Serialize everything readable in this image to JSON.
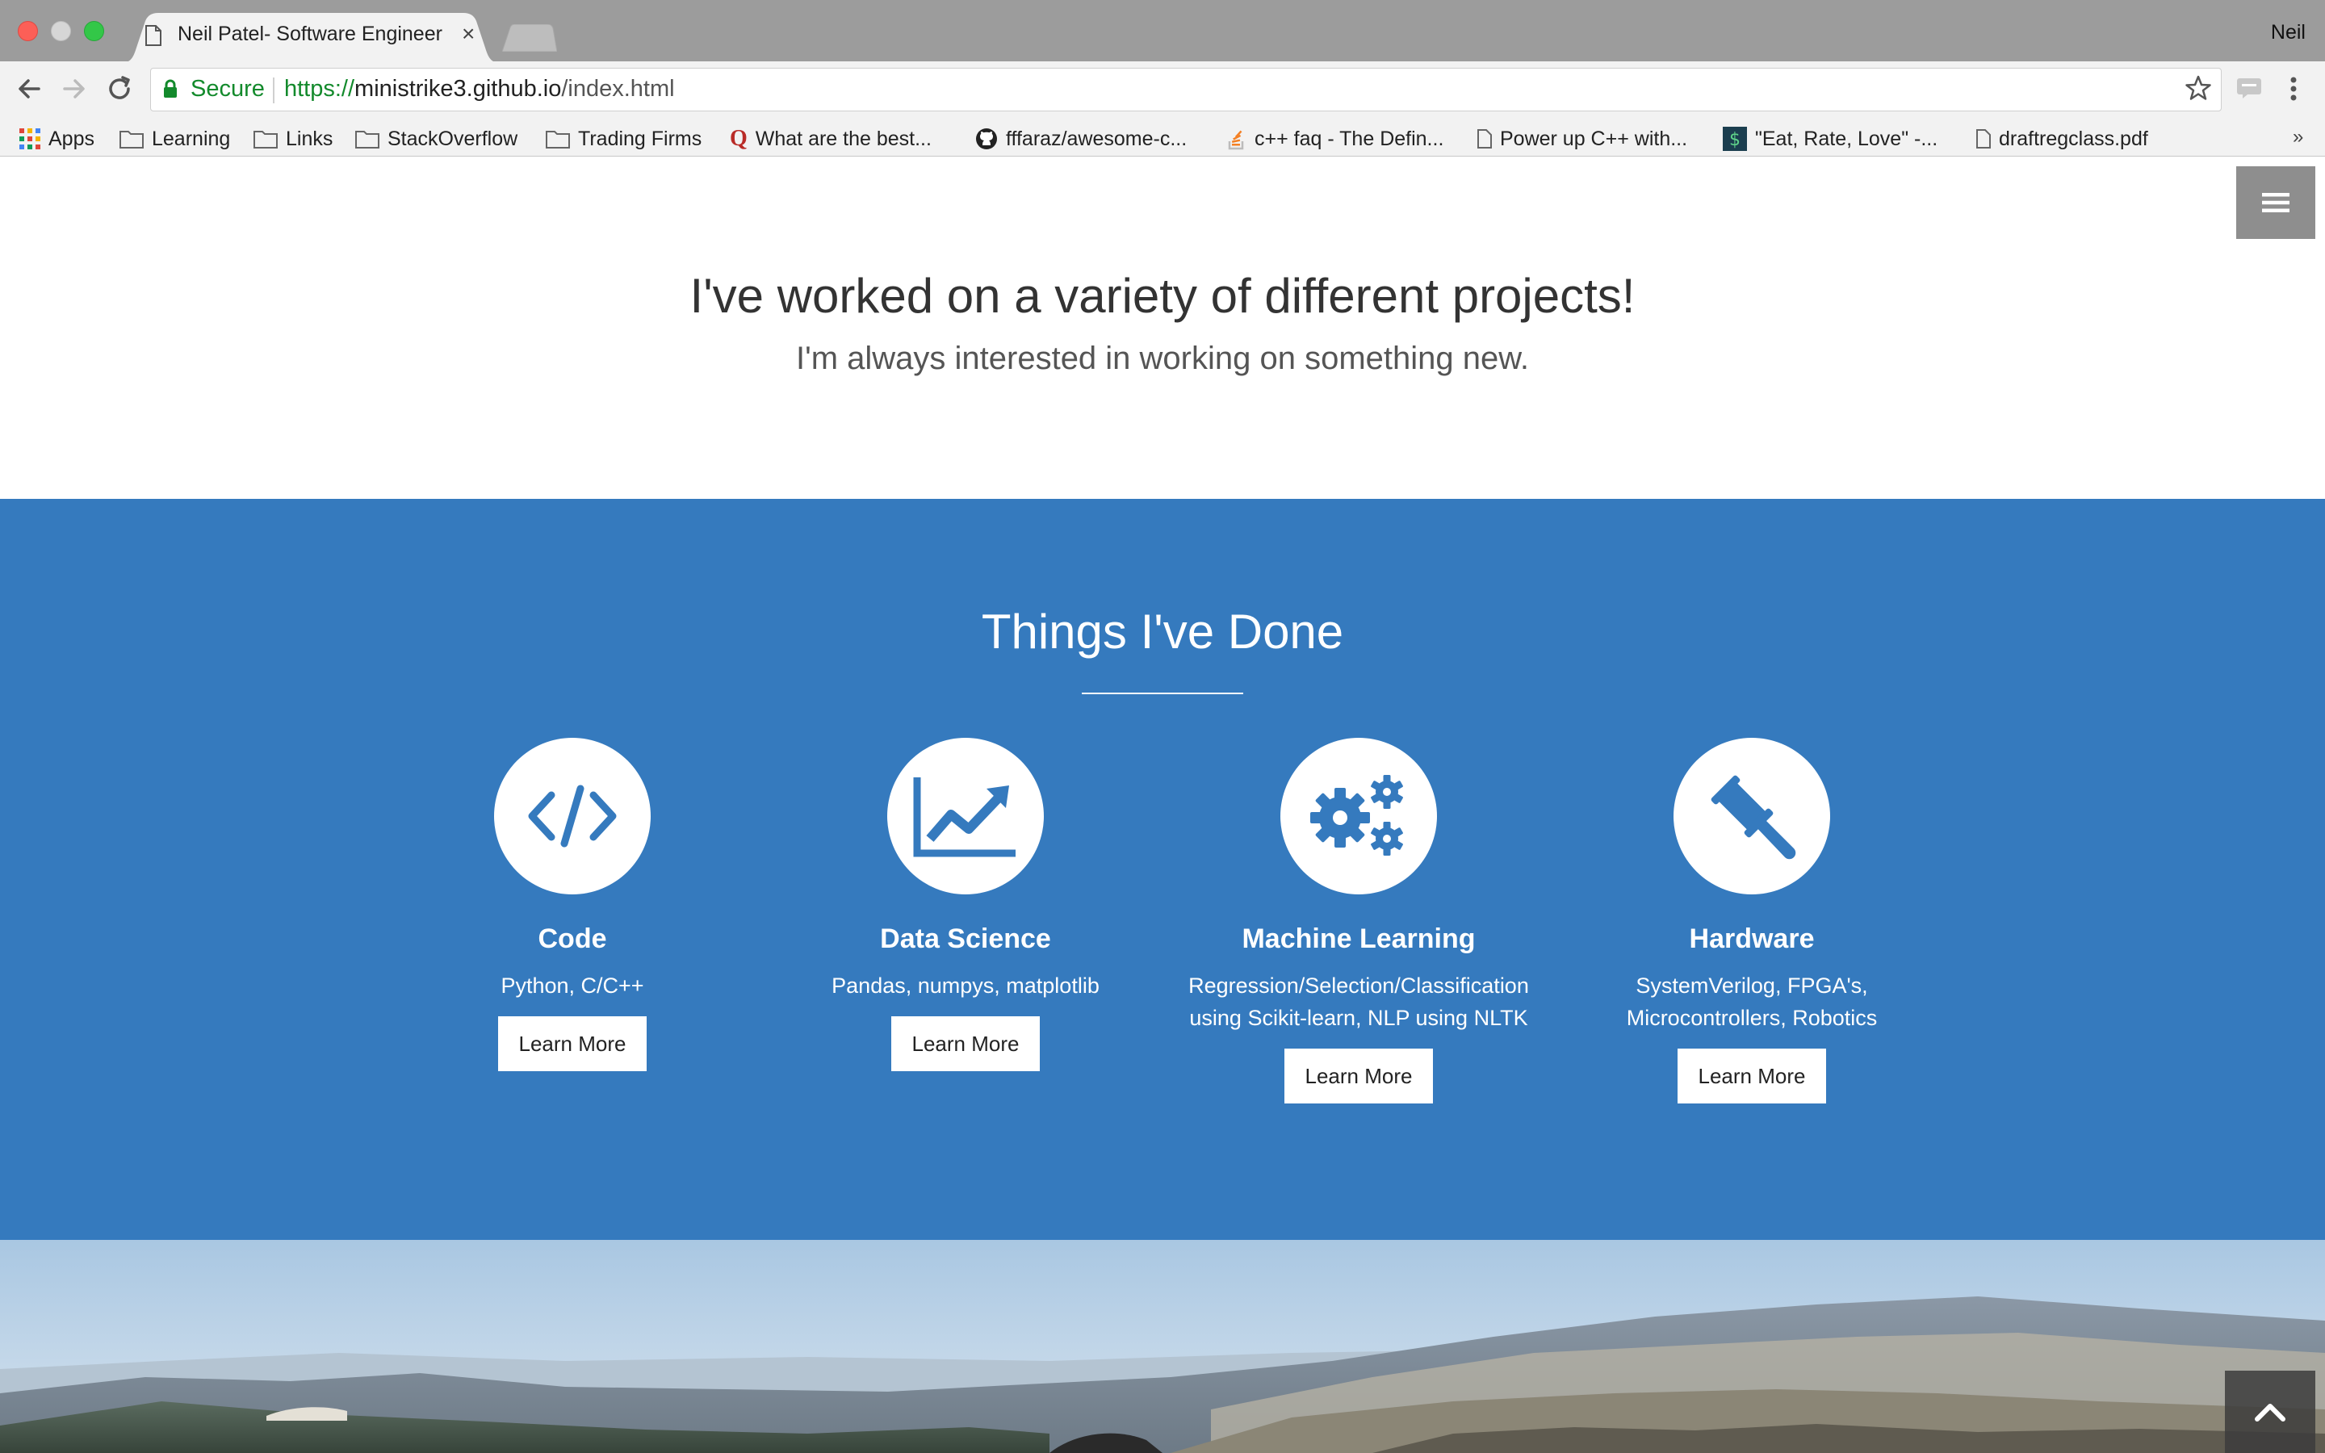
{
  "browser": {
    "tab_title": "Neil Patel- Software Engineer",
    "profile_name": "Neil",
    "secure_label": "Secure",
    "url_scheme": "https://",
    "url_host": "ministrike3.github.io",
    "url_path": "/index.html",
    "bookmarks": [
      {
        "label": "Apps",
        "icon": "apps-grid-icon"
      },
      {
        "label": "Learning",
        "icon": "folder-icon"
      },
      {
        "label": "Links",
        "icon": "folder-icon"
      },
      {
        "label": "StackOverflow",
        "icon": "folder-icon"
      },
      {
        "label": "Trading Firms",
        "icon": "folder-icon"
      },
      {
        "label": "What are the best...",
        "icon": "quora-icon"
      },
      {
        "label": "fffaraz/awesome-c...",
        "icon": "github-icon"
      },
      {
        "label": "c++ faq - The Defin...",
        "icon": "stackoverflow-icon"
      },
      {
        "label": "Power up C++ with...",
        "icon": "page-icon"
      },
      {
        "label": "\"Eat, Rate, Love\" -...",
        "icon": "site-favicon-icon"
      },
      {
        "label": "draftregclass.pdf",
        "icon": "page-icon"
      }
    ],
    "more_bookmarks": "»"
  },
  "intro": {
    "heading": "I've worked on a variety of different projects!",
    "subheading": "I'm always interested in working on something new."
  },
  "services": {
    "heading": "Things I've Done",
    "items": [
      {
        "title": "Code",
        "lines": [
          "Python, C/C++"
        ],
        "button": "Learn More",
        "icon": "code-icon"
      },
      {
        "title": "Data Science",
        "lines": [
          "Pandas, numpys, matplotlib"
        ],
        "button": "Learn More",
        "icon": "line-chart-icon"
      },
      {
        "title": "Machine Learning",
        "lines": [
          "Regression/Selection/Classification",
          "using Scikit-learn, NLP using NLTK"
        ],
        "button": "Learn More",
        "icon": "gears-icon"
      },
      {
        "title": "Hardware",
        "lines": [
          "SystemVerilog, FPGA's,",
          "Microcontrollers, Robotics"
        ],
        "button": "Learn More",
        "icon": "gavel-icon"
      }
    ]
  },
  "colors": {
    "services_bg": "#357abe",
    "secure_green": "#138a2c",
    "menu_toggle": "#8e8e8e"
  }
}
